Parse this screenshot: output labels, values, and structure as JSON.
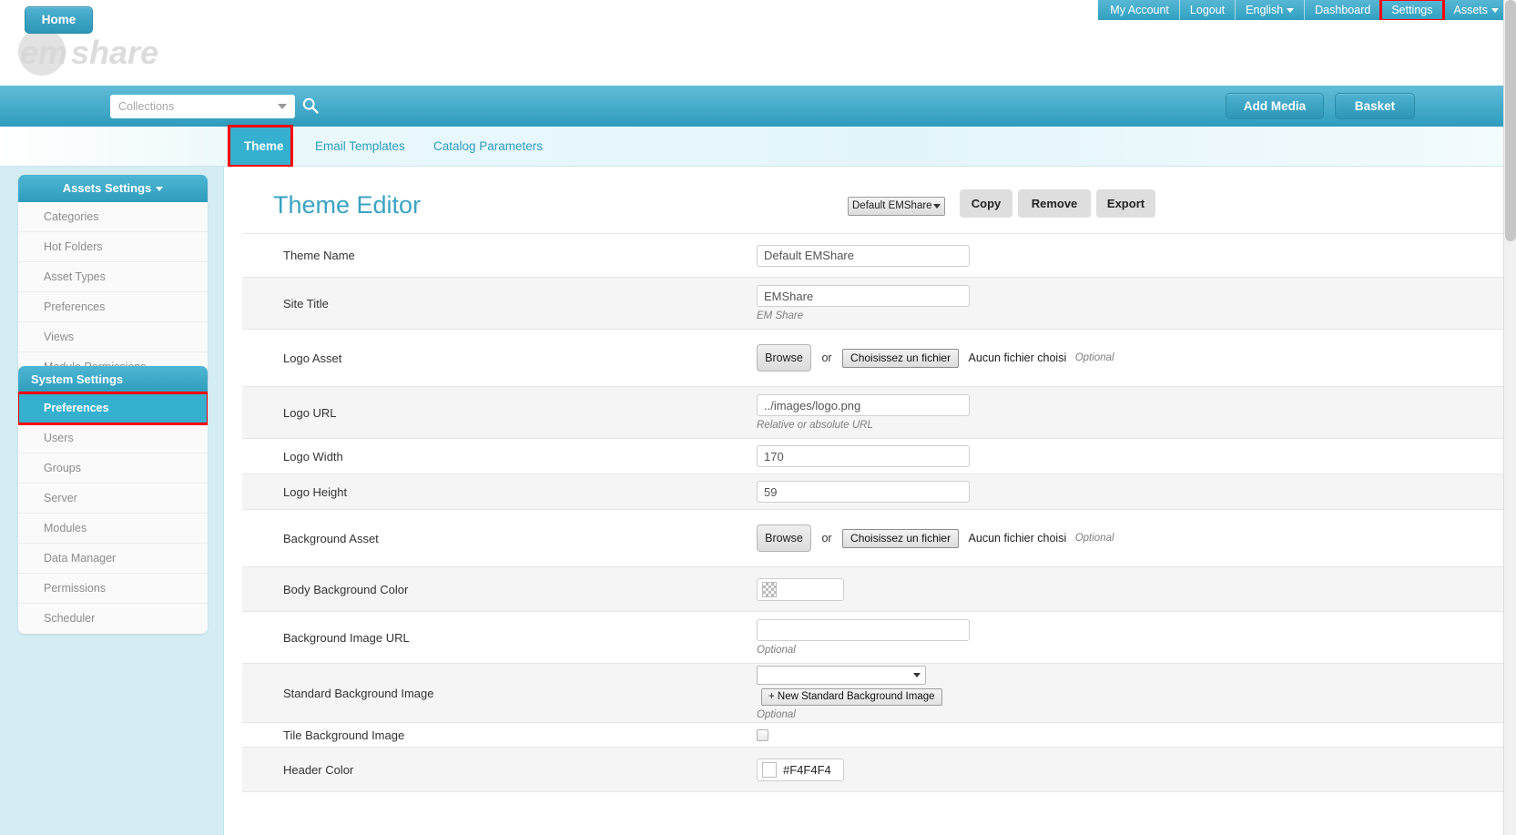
{
  "topnav": {
    "items": [
      {
        "label": "My Account",
        "caret": false,
        "highlighted": false
      },
      {
        "label": "Logout",
        "caret": false,
        "highlighted": false
      },
      {
        "label": "English",
        "caret": true,
        "highlighted": false
      },
      {
        "label": "Dashboard",
        "caret": false,
        "highlighted": false
      },
      {
        "label": "Settings",
        "caret": false,
        "highlighted": true
      },
      {
        "label": "Assets",
        "caret": true,
        "highlighted": false
      }
    ]
  },
  "brand": {
    "logo_text": "emshare",
    "logo_part1": "em",
    "logo_part2": "share"
  },
  "mainnav": {
    "home_label": "Home",
    "collections_placeholder": "Collections",
    "search_icon": "search-icon",
    "add_media_label": "Add Media",
    "basket_label": "Basket"
  },
  "tabs": [
    {
      "label": "Theme",
      "active": true,
      "highlighted": true
    },
    {
      "label": "Email Templates",
      "active": false,
      "highlighted": false
    },
    {
      "label": "Catalog Parameters",
      "active": false,
      "highlighted": false
    }
  ],
  "sidebar": {
    "assets_settings": {
      "title": "Assets Settings",
      "caret": true,
      "items": [
        {
          "label": "Categories",
          "selected": false
        },
        {
          "label": "Hot Folders",
          "selected": false
        },
        {
          "label": "Asset Types",
          "selected": false
        },
        {
          "label": "Preferences",
          "selected": false
        },
        {
          "label": "Views",
          "selected": false
        },
        {
          "label": "Module Permissions",
          "selected": false
        }
      ]
    },
    "system_settings": {
      "title": "System Settings",
      "items": [
        {
          "label": "Preferences",
          "selected": true,
          "highlighted": true
        },
        {
          "label": "Users",
          "selected": false
        },
        {
          "label": "Groups",
          "selected": false
        },
        {
          "label": "Server",
          "selected": false
        },
        {
          "label": "Modules",
          "selected": false
        },
        {
          "label": "Data Manager",
          "selected": false
        },
        {
          "label": "Permissions",
          "selected": false
        },
        {
          "label": "Scheduler",
          "selected": false
        }
      ]
    }
  },
  "main": {
    "page_title": "Theme Editor",
    "theme_selector_value": "Default EMShare",
    "copy_label": "Copy",
    "remove_label": "Remove",
    "export_label": "Export",
    "labels": {
      "theme_name": "Theme Name",
      "site_title": "Site Title",
      "logo_asset": "Logo Asset",
      "logo_url": "Logo URL",
      "logo_width": "Logo Width",
      "logo_height": "Logo Height",
      "background_asset": "Background Asset",
      "body_background_color": "Body Background Color",
      "background_image_url": "Background Image URL",
      "standard_background_image": "Standard Background Image",
      "tile_background_image": "Tile Background Image",
      "header_color": "Header Color"
    },
    "values": {
      "theme_name": "Default EMShare",
      "site_title": "EMShare",
      "logo_url": "../images/logo.png",
      "logo_width": "170",
      "logo_height": "59",
      "background_image_url": "",
      "standard_background_image": "",
      "header_color": "#F4F4F4"
    },
    "hints": {
      "site_title": "EM Share",
      "logo_url": "Relative or absolute URL",
      "optional": "Optional"
    },
    "buttons": {
      "browse": "Browse",
      "or": "or",
      "choose_file": "Choisissez un fichier",
      "no_file_chosen": "Aucun fichier choisi",
      "new_standard_background_image": "+ New Standard Background Image"
    }
  },
  "colors": {
    "teal": "#35b0ce",
    "teal_dark": "#2e9cbd",
    "sidebar_bg": "#d4edf4",
    "title_blue": "#3aa3c4",
    "highlight_red": "#ff0000",
    "header_color_value": "#F4F4F4"
  }
}
